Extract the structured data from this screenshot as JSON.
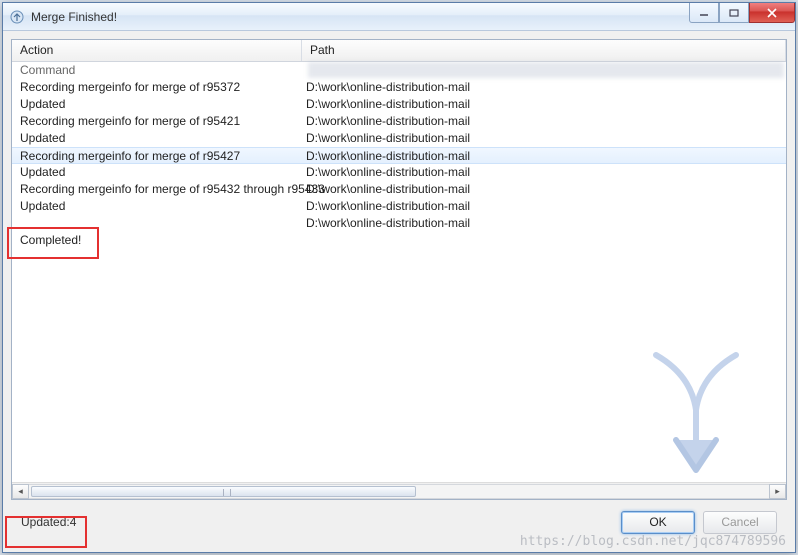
{
  "window": {
    "title": "Merge Finished!",
    "icon": "merge-icon"
  },
  "headers": {
    "action": "Action",
    "path": "Path"
  },
  "rows": [
    {
      "action": "Command",
      "path": "",
      "type": "command"
    },
    {
      "action": "Recording mergeinfo for merge of r95372",
      "path": "D:\\work\\online-distribution-mail"
    },
    {
      "action": "Updated",
      "path": "D:\\work\\online-distribution-mail"
    },
    {
      "action": "Recording mergeinfo for merge of r95421",
      "path": "D:\\work\\online-distribution-mail"
    },
    {
      "action": "Updated",
      "path": "D:\\work\\online-distribution-mail"
    },
    {
      "action": "Recording mergeinfo for merge of r95427",
      "path": "D:\\work\\online-distribution-mail",
      "selected": true
    },
    {
      "action": "Updated",
      "path": "D:\\work\\online-distribution-mail"
    },
    {
      "action": "Recording mergeinfo for merge of r95432 through r95433",
      "path": "D:\\work\\online-distribution-mail"
    },
    {
      "action": "Updated",
      "path": "D:\\work\\online-distribution-mail"
    },
    {
      "action": "",
      "path": "D:\\work\\online-distribution-mail"
    },
    {
      "action": "Completed!",
      "path": ""
    }
  ],
  "status": "Updated:4",
  "buttons": {
    "ok": "OK",
    "cancel": "Cancel"
  },
  "watermark": "https://blog.csdn.net/jqc874789596"
}
